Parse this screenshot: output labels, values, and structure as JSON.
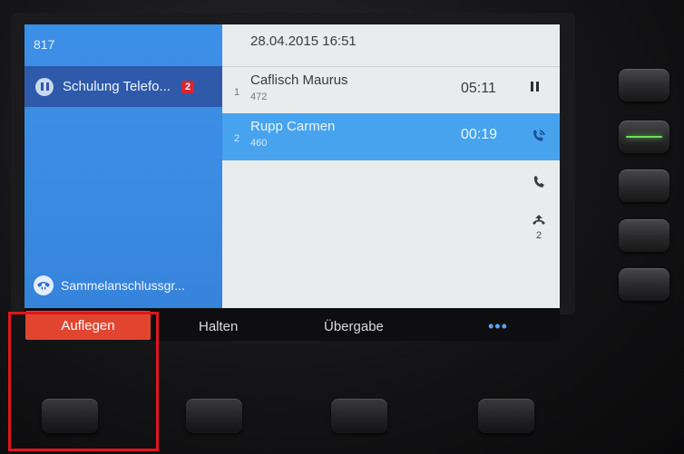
{
  "left_panel": {
    "extension": "817",
    "active_line": {
      "label": "Schulung Telefo...",
      "badge_count": "2",
      "icon": "pause-icon"
    },
    "hunt_group": {
      "label": "Sammelanschlussgr...",
      "icon": "hunt-group-icon"
    }
  },
  "header": {
    "datetime": "28.04.2015 16:51"
  },
  "calls": [
    {
      "index": "1",
      "name": "Caflisch Maurus",
      "number": "472",
      "timer": "05:11",
      "state_icon": "held-icon"
    },
    {
      "index": "2",
      "name": "Rupp Carmen",
      "number": "460",
      "timer": "00:19",
      "state_icon": "active-call-icon"
    }
  ],
  "actions": {
    "call_icon": "phone-icon",
    "pickup_icon": "pickup-icon",
    "pickup_count": "2"
  },
  "softkeys": {
    "hangup": "Auflegen",
    "hold": "Halten",
    "transfer": "Übergabe",
    "more": "•••"
  },
  "colors": {
    "left_panel": "#3c8fe6",
    "selected_line": "#2e5aa9",
    "selected_call": "#47a3ee",
    "badge": "#d9262c",
    "hangup_button": "#e2452f",
    "line_led": "#6fe05c",
    "highlight_box": "#e3141c"
  }
}
